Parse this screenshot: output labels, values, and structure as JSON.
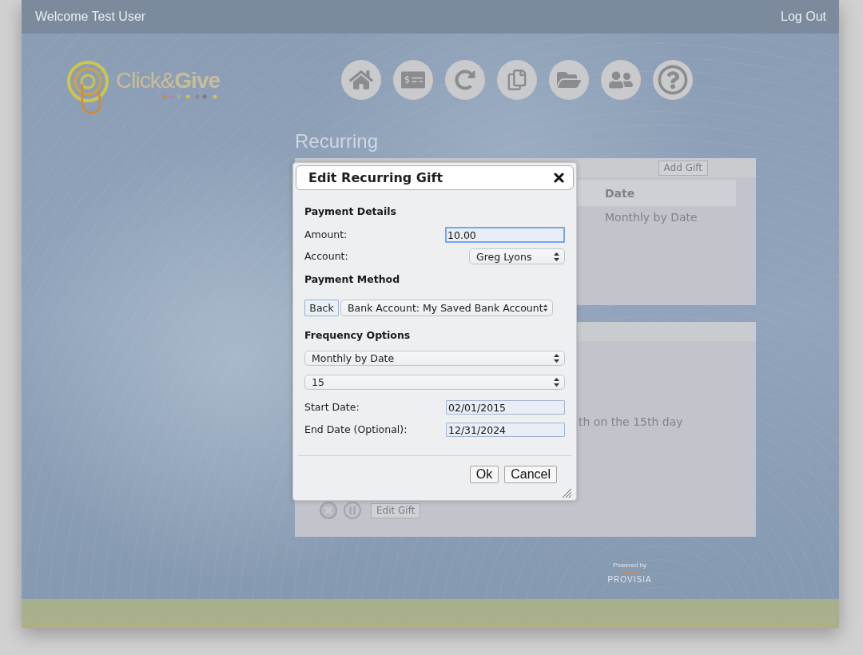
{
  "header": {
    "welcome": "Welcome Test User",
    "logout": "Log Out"
  },
  "logo": {
    "text": "Click&**Give**"
  },
  "page_title": "Recurring",
  "recurring_panel": {
    "add_gift": "Add Gift",
    "table": {
      "columns": [
        "Date"
      ],
      "rows": [
        [
          "Monthly by Date"
        ]
      ]
    }
  },
  "detail_panel": {
    "detail_text": "th on the 15th day",
    "edit_gift": "Edit Gift"
  },
  "dialog": {
    "title": "Edit Recurring Gift",
    "payment_details": {
      "heading": "Payment Details",
      "amount": {
        "label": "Amount:",
        "value": "10.00",
        "focused": true
      },
      "account": {
        "label": "Account:",
        "value": "Greg Lyons"
      }
    },
    "payment_method": {
      "heading": "Payment Method",
      "back": "Back",
      "method": "Bank Account: My Saved Bank Account"
    },
    "frequency": {
      "heading": "Frequency Options",
      "frequency": "Monthly by Date",
      "day": "15",
      "start": {
        "label": "Start Date:",
        "value": "02/01/2015"
      },
      "end": {
        "label": "End Date (Optional):",
        "value": "12/31/2024"
      }
    },
    "buttons": [
      "Ok",
      "Cancel"
    ]
  },
  "footer": {
    "powered_by": "Powered by",
    "brand": "PROVISIA"
  }
}
